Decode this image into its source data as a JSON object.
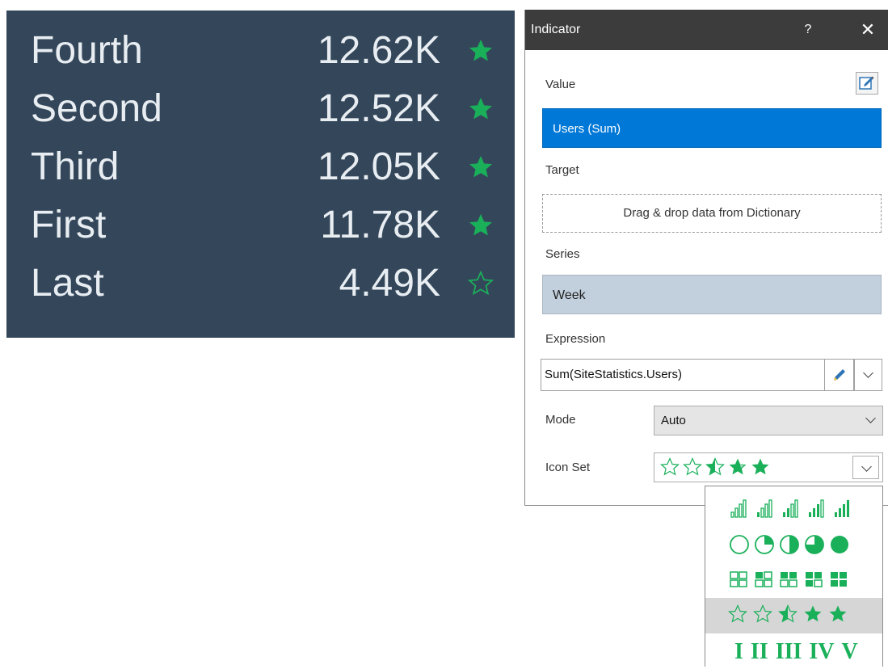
{
  "indicator_table": {
    "rows": [
      {
        "label": "Fourth",
        "value": "12.62K",
        "star": "full"
      },
      {
        "label": "Second",
        "value": "12.52K",
        "star": "full"
      },
      {
        "label": "Third",
        "value": "12.05K",
        "star": "full"
      },
      {
        "label": "First",
        "value": "11.78K",
        "star": "full"
      },
      {
        "label": "Last",
        "value": "4.49K",
        "star": "empty"
      }
    ],
    "colors": {
      "background": "#34475a",
      "text": "#e8edf2",
      "icon": "#1ab05a"
    }
  },
  "dialog": {
    "title": "Indicator",
    "help_label": "?",
    "close_label": "✕",
    "value_label": "Value",
    "value_field": "Users (Sum)",
    "target_label": "Target",
    "target_placeholder": "Drag & drop data from Dictionary",
    "series_label": "Series",
    "series_field": "Week",
    "expression_label": "Expression",
    "expression_value": "Sum(SiteStatistics.Users)",
    "mode_label": "Mode",
    "mode_value": "Auto",
    "iconset_label": "Icon Set",
    "iconset_value": "stars",
    "colors": {
      "titlebar": "#3c3c3c",
      "selected_field": "#0078d7",
      "series_field": "#c2cfdc",
      "icon_green": "#1ab05a"
    }
  },
  "iconset_list": {
    "options": [
      {
        "name": "signal-bars",
        "icon": "signal-bars-icon"
      },
      {
        "name": "pie-quarters",
        "icon": "pie-quarters-icon"
      },
      {
        "name": "quadrants",
        "icon": "quadrants-icon"
      },
      {
        "name": "stars",
        "icon": "star-icon",
        "selected": true
      },
      {
        "name": "roman-numerals",
        "labels": [
          "I",
          "II",
          "III",
          "IV",
          "V"
        ]
      }
    ]
  }
}
